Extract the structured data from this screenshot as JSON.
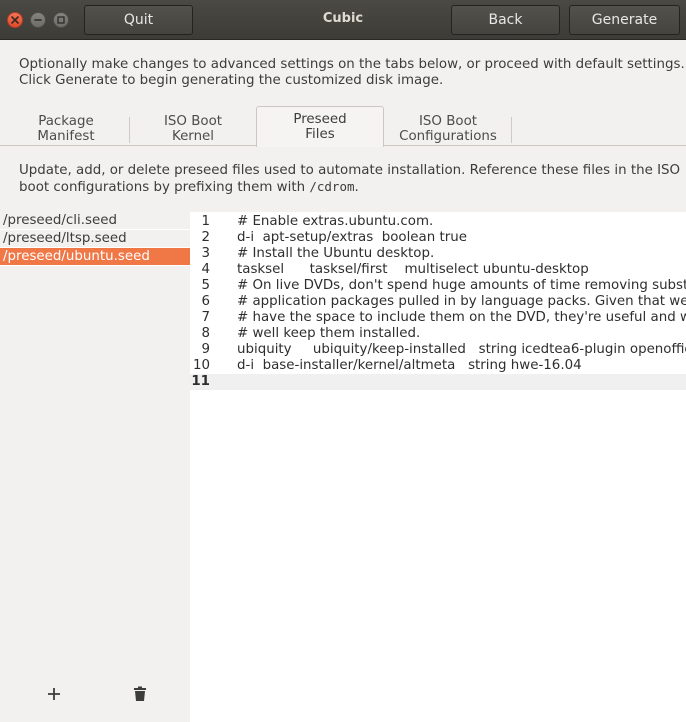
{
  "window": {
    "title": "Cubic",
    "quit_label": "Quit",
    "back_label": "Back",
    "generate_label": "Generate"
  },
  "intro": {
    "line1": "Optionally make changes to advanced settings on the tabs below, or proceed with default settings.",
    "line2": "Click Generate to begin generating the customized disk image."
  },
  "tabs": [
    {
      "line1": "Package",
      "line2": "Manifest"
    },
    {
      "line1": "ISO Boot",
      "line2": "Kernel"
    },
    {
      "line1": "Preseed",
      "line2": "Files",
      "active": true
    },
    {
      "line1": "ISO Boot",
      "line2": "Configurations"
    }
  ],
  "description": {
    "line1": "Update, add, or delete preseed files used to automate installation. Reference these files in the ISO",
    "line2_before": "boot configurations by prefixing them with ",
    "line2_code": "/cdrom",
    "line2_after": "."
  },
  "files": [
    {
      "name": "/preseed/cli.seed",
      "selected": false
    },
    {
      "name": "/preseed/ltsp.seed",
      "selected": false
    },
    {
      "name": "/preseed/ubuntu.seed",
      "selected": true
    }
  ],
  "file_actions": {
    "add_icon": "plus-icon",
    "delete_icon": "trash-icon"
  },
  "editor": {
    "current_line": 11,
    "lines": [
      {
        "num": "1",
        "text": "# Enable extras.ubuntu.com."
      },
      {
        "num": "2",
        "text": "d-i  apt-setup/extras  boolean true"
      },
      {
        "num": "3",
        "text": "# Install the Ubuntu desktop."
      },
      {
        "num": "4",
        "text": "tasksel      tasksel/first    multiselect ubuntu-desktop"
      },
      {
        "num": "5",
        "text": "# On live DVDs, don't spend huge amounts of time removing substant"
      },
      {
        "num": "6",
        "text": "# application packages pulled in by language packs. Given that we clea"
      },
      {
        "num": "7",
        "text": "# have the space to include them on the DVD, they're useful and we mi"
      },
      {
        "num": "8",
        "text": "# well keep them installed."
      },
      {
        "num": "9",
        "text": "ubiquity     ubiquity/keep-installed   string icedtea6-plugin openoffice.o"
      },
      {
        "num": "10",
        "text": "d-i  base-installer/kernel/altmeta   string hwe-16.04"
      },
      {
        "num": "11",
        "text": ""
      }
    ]
  },
  "colors": {
    "selection": "#f07746",
    "close_button": "#e95420",
    "header": "#3f3e39"
  }
}
